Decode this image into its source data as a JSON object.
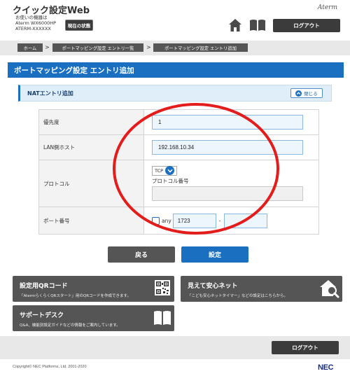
{
  "header": {
    "app_title": "クイック設定Web",
    "device_caption": "お使いの機器は",
    "device_model": "Aterm WX6000HP",
    "device_id": "ATERM-XXXXXX",
    "status_button": "現在の状態",
    "brand": "Aterm",
    "home_icon": "home-icon",
    "manual_icon": "book-icon",
    "logout_button": "ログアウト"
  },
  "breadcrumb": [
    {
      "label": "ホーム"
    },
    {
      "label": "ポートマッピング設定 エントリ一覧"
    },
    {
      "label": "ポートマッピング設定 エントリ追加"
    }
  ],
  "breadcrumb_separator": ">",
  "page_title": "ポートマッピング設定 エントリ追加",
  "section": {
    "title": "NATエントリ追加",
    "collapse_button": "閉じる"
  },
  "form": {
    "priority_label": "優先度",
    "priority_value": "1",
    "lan_host_label": "LAN側ホスト",
    "lan_host_value": "192.168.10.34",
    "protocol_label": "プロトコル",
    "protocol_selected": "TCP",
    "protocol_number_label": "プロトコル番号",
    "protocol_number_value": "",
    "port_label": "ポート番号",
    "any_label": "any",
    "any_checked": false,
    "port_from": "1723",
    "port_separator": "-",
    "port_to": ""
  },
  "actions": {
    "back": "戻る",
    "submit": "設定"
  },
  "cards": {
    "qr": {
      "title": "設定用QRコード",
      "desc": "「AtermらくらくQRスタート」用のQRコードを作成できます。",
      "icon": "qr-code-icon"
    },
    "safety": {
      "title": "見えて安心ネット",
      "desc": "「こども安心ネットタイマー」などの設定はこちらから。",
      "icon": "house-magnifier-icon"
    },
    "support": {
      "title": "サポートデスク",
      "desc": "Q&A、機能別設定ガイドなどの情報をご案内しています。",
      "icon": "book-icon"
    }
  },
  "footer": {
    "logout_button": "ログアウト",
    "copyright": "Copyright© NEC Platforms, Ltd. 2001-2020",
    "logo": "NEC"
  },
  "colors": {
    "accent_blue": "#1a6fc0",
    "annotation_red": "#e31c1c",
    "dark_button": "#555555"
  }
}
